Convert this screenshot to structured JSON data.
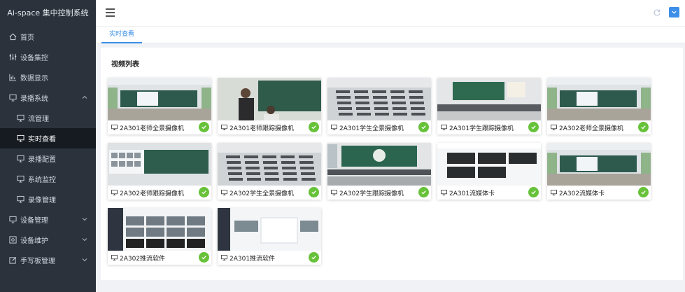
{
  "app": {
    "title": "Ai-space 集中控制系统"
  },
  "sidebar": {
    "items": [
      {
        "label": "首页",
        "icon": "home-icon",
        "level": 1
      },
      {
        "label": "设备集控",
        "icon": "sliders-icon",
        "level": 1
      },
      {
        "label": "数据显示",
        "icon": "chart-icon",
        "level": 1
      },
      {
        "label": "录播系统",
        "icon": "monitor-icon",
        "level": 1,
        "expanded": true
      },
      {
        "label": "流管理",
        "icon": "monitor-icon",
        "level": 2
      },
      {
        "label": "实时查看",
        "icon": "monitor-icon",
        "level": 2,
        "active": true
      },
      {
        "label": "录播配置",
        "icon": "monitor-icon",
        "level": 2
      },
      {
        "label": "系统监控",
        "icon": "monitor-icon",
        "level": 2
      },
      {
        "label": "录像管理",
        "icon": "monitor-icon",
        "level": 2
      },
      {
        "label": "设备管理",
        "icon": "monitor-icon",
        "level": 1,
        "expanded": false
      },
      {
        "label": "设备维护",
        "icon": "device-icon",
        "level": 1,
        "expanded": false
      },
      {
        "label": "手写板管理",
        "icon": "edit-icon",
        "level": 1,
        "expanded": false
      }
    ]
  },
  "tabs": [
    {
      "label": "实时查看",
      "active": true
    }
  ],
  "panel": {
    "title": "视频列表"
  },
  "videos": [
    {
      "label": "2A301老师全景摄像机",
      "scene": "classroom-front",
      "status": "online"
    },
    {
      "label": "2A301老师跟踪摄像机",
      "scene": "teacher-close",
      "status": "online"
    },
    {
      "label": "2A301学生全景摄像机",
      "scene": "classroom-desks",
      "status": "online"
    },
    {
      "label": "2A301学生跟踪摄像机",
      "scene": "classroom-board",
      "status": "online"
    },
    {
      "label": "2A302老师全景摄像机",
      "scene": "classroom-front",
      "status": "online"
    },
    {
      "label": "2A302老师跟踪摄像机",
      "scene": "board-screens",
      "status": "online"
    },
    {
      "label": "2A302学生全景摄像机",
      "scene": "classroom-desks",
      "status": "online"
    },
    {
      "label": "2A302学生跟踪摄像机",
      "scene": "classroom-board-logo",
      "status": "online"
    },
    {
      "label": "2A301流媒体卡",
      "scene": "software-dark",
      "status": "online"
    },
    {
      "label": "2A302流媒体卡",
      "scene": "classroom-front",
      "status": "online"
    },
    {
      "label": "2A302推流软件",
      "scene": "software-grid",
      "status": "online"
    },
    {
      "label": "2A301推流软件",
      "scene": "software-light",
      "status": "online"
    }
  ],
  "colors": {
    "sidebar": "#2b323b",
    "active_item": "#161b21",
    "accent": "#3a8ee6",
    "status_ok": "#67c23a"
  }
}
